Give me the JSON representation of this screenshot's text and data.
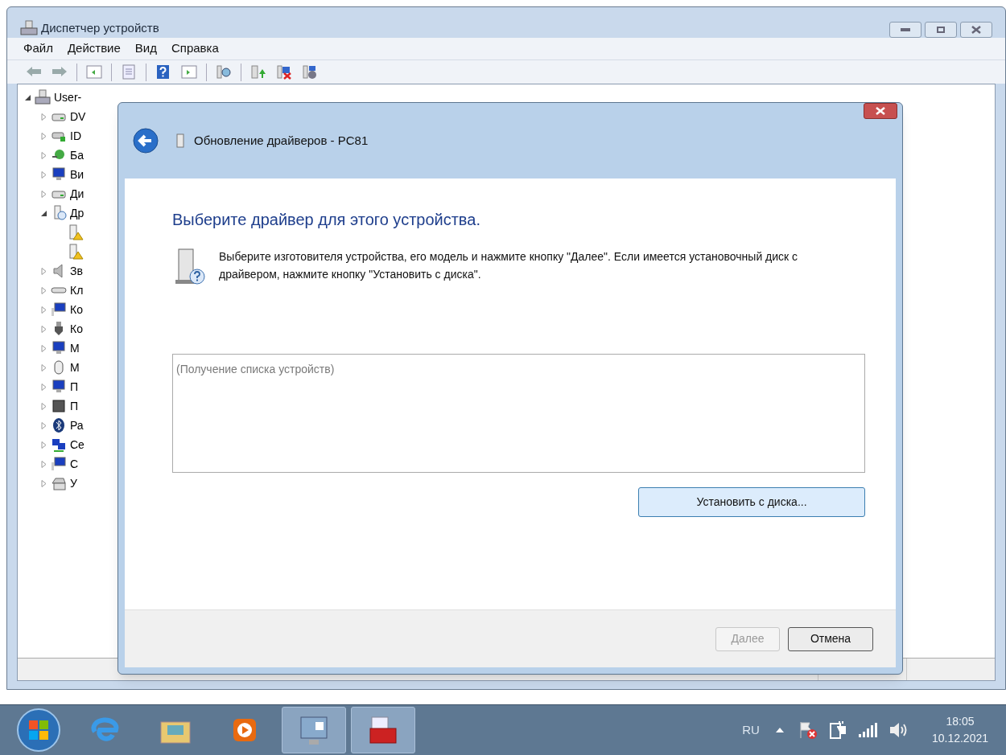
{
  "window": {
    "title": "Диспетчер устройств"
  },
  "menu": [
    "Файл",
    "Действие",
    "Вид",
    "Справка"
  ],
  "tree": {
    "label": "User-",
    "expanded": true,
    "children": [
      {
        "label": "DV",
        "kind": "drive",
        "expanded": false
      },
      {
        "label": "ID",
        "kind": "controller",
        "expanded": false
      },
      {
        "label": "Ба",
        "kind": "battery",
        "expanded": false
      },
      {
        "label": "Ви",
        "kind": "monitor",
        "expanded": false
      },
      {
        "label": "Ди",
        "kind": "drive",
        "expanded": false
      },
      {
        "label": "Др",
        "kind": "unknown",
        "expanded": true,
        "children": [
          {
            "warning": true
          },
          {
            "warning": true
          }
        ]
      },
      {
        "label": "Зв",
        "kind": "speaker",
        "expanded": false
      },
      {
        "label": "Кл",
        "kind": "keyboard",
        "expanded": false
      },
      {
        "label": "Ко",
        "kind": "computer",
        "expanded": false
      },
      {
        "label": "Ко",
        "kind": "usb",
        "expanded": false
      },
      {
        "label": "М",
        "kind": "monitor",
        "expanded": false
      },
      {
        "label": "М",
        "kind": "mouse",
        "expanded": false
      },
      {
        "label": "П",
        "kind": "monitor",
        "expanded": false
      },
      {
        "label": "П",
        "kind": "chip",
        "expanded": false
      },
      {
        "label": "Ра",
        "kind": "bluetooth",
        "expanded": false
      },
      {
        "label": "Се",
        "kind": "network",
        "expanded": false
      },
      {
        "label": "С",
        "kind": "computer",
        "expanded": false
      },
      {
        "label": "У",
        "kind": "printer",
        "expanded": false
      }
    ]
  },
  "dialog": {
    "title": "Обновление драйверов - PC81",
    "heading": "Выберите драйвер для этого устройства.",
    "description": "Выберите изготовителя устройства, его модель и нажмите кнопку \"Далее\". Если имеется установочный диск с  драйвером, нажмите кнопку \"Установить с диска\".",
    "list_placeholder": "(Получение списка устройств)",
    "have_disk_button": "Установить с диска...",
    "buttons": [
      {
        "label": "Далее",
        "disabled": true
      },
      {
        "label": "Отмена",
        "disabled": false
      }
    ]
  },
  "taskbar": {
    "apps": [
      {
        "kind": "ie",
        "selected": false
      },
      {
        "kind": "folder",
        "selected": false
      },
      {
        "kind": "media",
        "selected": false
      },
      {
        "kind": "control",
        "selected": true
      },
      {
        "kind": "toolbox",
        "selected": true
      }
    ],
    "language": "RU",
    "time": "18:05",
    "date": "10.12.2021"
  }
}
